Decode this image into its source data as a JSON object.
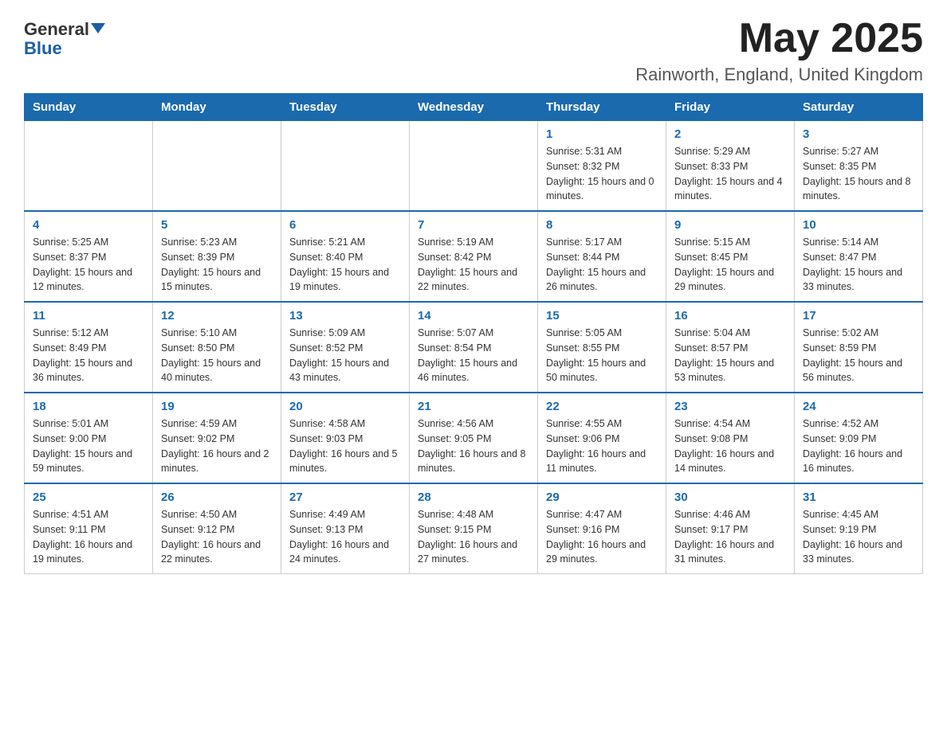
{
  "header": {
    "logo_general": "General",
    "logo_blue": "Blue",
    "month_year": "May 2025",
    "location": "Rainworth, England, United Kingdom"
  },
  "weekdays": [
    "Sunday",
    "Monday",
    "Tuesday",
    "Wednesday",
    "Thursday",
    "Friday",
    "Saturday"
  ],
  "weeks": [
    [
      {
        "day": "",
        "sunrise": "",
        "sunset": "",
        "daylight": ""
      },
      {
        "day": "",
        "sunrise": "",
        "sunset": "",
        "daylight": ""
      },
      {
        "day": "",
        "sunrise": "",
        "sunset": "",
        "daylight": ""
      },
      {
        "day": "",
        "sunrise": "",
        "sunset": "",
        "daylight": ""
      },
      {
        "day": "1",
        "sunrise": "Sunrise: 5:31 AM",
        "sunset": "Sunset: 8:32 PM",
        "daylight": "Daylight: 15 hours and 0 minutes."
      },
      {
        "day": "2",
        "sunrise": "Sunrise: 5:29 AM",
        "sunset": "Sunset: 8:33 PM",
        "daylight": "Daylight: 15 hours and 4 minutes."
      },
      {
        "day": "3",
        "sunrise": "Sunrise: 5:27 AM",
        "sunset": "Sunset: 8:35 PM",
        "daylight": "Daylight: 15 hours and 8 minutes."
      }
    ],
    [
      {
        "day": "4",
        "sunrise": "Sunrise: 5:25 AM",
        "sunset": "Sunset: 8:37 PM",
        "daylight": "Daylight: 15 hours and 12 minutes."
      },
      {
        "day": "5",
        "sunrise": "Sunrise: 5:23 AM",
        "sunset": "Sunset: 8:39 PM",
        "daylight": "Daylight: 15 hours and 15 minutes."
      },
      {
        "day": "6",
        "sunrise": "Sunrise: 5:21 AM",
        "sunset": "Sunset: 8:40 PM",
        "daylight": "Daylight: 15 hours and 19 minutes."
      },
      {
        "day": "7",
        "sunrise": "Sunrise: 5:19 AM",
        "sunset": "Sunset: 8:42 PM",
        "daylight": "Daylight: 15 hours and 22 minutes."
      },
      {
        "day": "8",
        "sunrise": "Sunrise: 5:17 AM",
        "sunset": "Sunset: 8:44 PM",
        "daylight": "Daylight: 15 hours and 26 minutes."
      },
      {
        "day": "9",
        "sunrise": "Sunrise: 5:15 AM",
        "sunset": "Sunset: 8:45 PM",
        "daylight": "Daylight: 15 hours and 29 minutes."
      },
      {
        "day": "10",
        "sunrise": "Sunrise: 5:14 AM",
        "sunset": "Sunset: 8:47 PM",
        "daylight": "Daylight: 15 hours and 33 minutes."
      }
    ],
    [
      {
        "day": "11",
        "sunrise": "Sunrise: 5:12 AM",
        "sunset": "Sunset: 8:49 PM",
        "daylight": "Daylight: 15 hours and 36 minutes."
      },
      {
        "day": "12",
        "sunrise": "Sunrise: 5:10 AM",
        "sunset": "Sunset: 8:50 PM",
        "daylight": "Daylight: 15 hours and 40 minutes."
      },
      {
        "day": "13",
        "sunrise": "Sunrise: 5:09 AM",
        "sunset": "Sunset: 8:52 PM",
        "daylight": "Daylight: 15 hours and 43 minutes."
      },
      {
        "day": "14",
        "sunrise": "Sunrise: 5:07 AM",
        "sunset": "Sunset: 8:54 PM",
        "daylight": "Daylight: 15 hours and 46 minutes."
      },
      {
        "day": "15",
        "sunrise": "Sunrise: 5:05 AM",
        "sunset": "Sunset: 8:55 PM",
        "daylight": "Daylight: 15 hours and 50 minutes."
      },
      {
        "day": "16",
        "sunrise": "Sunrise: 5:04 AM",
        "sunset": "Sunset: 8:57 PM",
        "daylight": "Daylight: 15 hours and 53 minutes."
      },
      {
        "day": "17",
        "sunrise": "Sunrise: 5:02 AM",
        "sunset": "Sunset: 8:59 PM",
        "daylight": "Daylight: 15 hours and 56 minutes."
      }
    ],
    [
      {
        "day": "18",
        "sunrise": "Sunrise: 5:01 AM",
        "sunset": "Sunset: 9:00 PM",
        "daylight": "Daylight: 15 hours and 59 minutes."
      },
      {
        "day": "19",
        "sunrise": "Sunrise: 4:59 AM",
        "sunset": "Sunset: 9:02 PM",
        "daylight": "Daylight: 16 hours and 2 minutes."
      },
      {
        "day": "20",
        "sunrise": "Sunrise: 4:58 AM",
        "sunset": "Sunset: 9:03 PM",
        "daylight": "Daylight: 16 hours and 5 minutes."
      },
      {
        "day": "21",
        "sunrise": "Sunrise: 4:56 AM",
        "sunset": "Sunset: 9:05 PM",
        "daylight": "Daylight: 16 hours and 8 minutes."
      },
      {
        "day": "22",
        "sunrise": "Sunrise: 4:55 AM",
        "sunset": "Sunset: 9:06 PM",
        "daylight": "Daylight: 16 hours and 11 minutes."
      },
      {
        "day": "23",
        "sunrise": "Sunrise: 4:54 AM",
        "sunset": "Sunset: 9:08 PM",
        "daylight": "Daylight: 16 hours and 14 minutes."
      },
      {
        "day": "24",
        "sunrise": "Sunrise: 4:52 AM",
        "sunset": "Sunset: 9:09 PM",
        "daylight": "Daylight: 16 hours and 16 minutes."
      }
    ],
    [
      {
        "day": "25",
        "sunrise": "Sunrise: 4:51 AM",
        "sunset": "Sunset: 9:11 PM",
        "daylight": "Daylight: 16 hours and 19 minutes."
      },
      {
        "day": "26",
        "sunrise": "Sunrise: 4:50 AM",
        "sunset": "Sunset: 9:12 PM",
        "daylight": "Daylight: 16 hours and 22 minutes."
      },
      {
        "day": "27",
        "sunrise": "Sunrise: 4:49 AM",
        "sunset": "Sunset: 9:13 PM",
        "daylight": "Daylight: 16 hours and 24 minutes."
      },
      {
        "day": "28",
        "sunrise": "Sunrise: 4:48 AM",
        "sunset": "Sunset: 9:15 PM",
        "daylight": "Daylight: 16 hours and 27 minutes."
      },
      {
        "day": "29",
        "sunrise": "Sunrise: 4:47 AM",
        "sunset": "Sunset: 9:16 PM",
        "daylight": "Daylight: 16 hours and 29 minutes."
      },
      {
        "day": "30",
        "sunrise": "Sunrise: 4:46 AM",
        "sunset": "Sunset: 9:17 PM",
        "daylight": "Daylight: 16 hours and 31 minutes."
      },
      {
        "day": "31",
        "sunrise": "Sunrise: 4:45 AM",
        "sunset": "Sunset: 9:19 PM",
        "daylight": "Daylight: 16 hours and 33 minutes."
      }
    ]
  ]
}
